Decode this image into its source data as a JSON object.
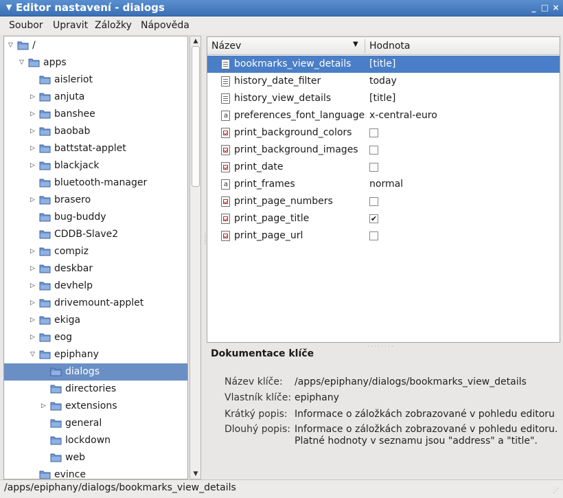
{
  "window": {
    "title": "Editor nastavení - dialogs",
    "menu_icon": "chevron-down-icon",
    "minimize": "_",
    "maximize": "□",
    "close": "×"
  },
  "menubar": [
    {
      "label": "Soubor"
    },
    {
      "label": "Upravit"
    },
    {
      "label": "Záložky"
    },
    {
      "label": "Nápověda"
    }
  ],
  "tree": {
    "items": [
      {
        "label": "/",
        "depth": 0,
        "expander": "open"
      },
      {
        "label": "apps",
        "depth": 1,
        "expander": "open"
      },
      {
        "label": "aisleriot",
        "depth": 2,
        "expander": "none"
      },
      {
        "label": "anjuta",
        "depth": 2,
        "expander": "closed"
      },
      {
        "label": "banshee",
        "depth": 2,
        "expander": "closed"
      },
      {
        "label": "baobab",
        "depth": 2,
        "expander": "closed"
      },
      {
        "label": "battstat-applet",
        "depth": 2,
        "expander": "closed"
      },
      {
        "label": "blackjack",
        "depth": 2,
        "expander": "closed"
      },
      {
        "label": "bluetooth-manager",
        "depth": 2,
        "expander": "none"
      },
      {
        "label": "brasero",
        "depth": 2,
        "expander": "closed"
      },
      {
        "label": "bug-buddy",
        "depth": 2,
        "expander": "none"
      },
      {
        "label": "CDDB-Slave2",
        "depth": 2,
        "expander": "none"
      },
      {
        "label": "compiz",
        "depth": 2,
        "expander": "closed"
      },
      {
        "label": "deskbar",
        "depth": 2,
        "expander": "closed"
      },
      {
        "label": "devhelp",
        "depth": 2,
        "expander": "closed"
      },
      {
        "label": "drivemount-applet",
        "depth": 2,
        "expander": "closed"
      },
      {
        "label": "ekiga",
        "depth": 2,
        "expander": "closed"
      },
      {
        "label": "eog",
        "depth": 2,
        "expander": "closed"
      },
      {
        "label": "epiphany",
        "depth": 2,
        "expander": "open"
      },
      {
        "label": "dialogs",
        "depth": 3,
        "expander": "none",
        "selected": true
      },
      {
        "label": "directories",
        "depth": 3,
        "expander": "none"
      },
      {
        "label": "extensions",
        "depth": 3,
        "expander": "closed"
      },
      {
        "label": "general",
        "depth": 3,
        "expander": "none"
      },
      {
        "label": "lockdown",
        "depth": 3,
        "expander": "none"
      },
      {
        "label": "web",
        "depth": 3,
        "expander": "none"
      },
      {
        "label": "evince",
        "depth": 2,
        "expander": "none"
      }
    ]
  },
  "keys": {
    "col_name": "Název",
    "col_value": "Hodnota",
    "rows": [
      {
        "name": "bookmarks_view_details",
        "type": "list",
        "value": "[title]",
        "selected": true
      },
      {
        "name": "history_date_filter",
        "type": "list",
        "value": "today"
      },
      {
        "name": "history_view_details",
        "type": "list",
        "value": "[title]"
      },
      {
        "name": "preferences_font_language",
        "type": "string",
        "value": "x-central-euro"
      },
      {
        "name": "print_background_colors",
        "type": "bool",
        "checked": false
      },
      {
        "name": "print_background_images",
        "type": "bool",
        "checked": false
      },
      {
        "name": "print_date",
        "type": "bool",
        "checked": false
      },
      {
        "name": "print_frames",
        "type": "string",
        "value": "normal"
      },
      {
        "name": "print_page_numbers",
        "type": "bool",
        "checked": false
      },
      {
        "name": "print_page_title",
        "type": "bool",
        "checked": true
      },
      {
        "name": "print_page_url",
        "type": "bool",
        "checked": false
      }
    ]
  },
  "doc": {
    "title": "Dokumentace klíče",
    "key_name_label": "Název klíče:",
    "key_name": "/apps/epiphany/dialogs/bookmarks_view_details",
    "owner_label": "Vlastník klíče:",
    "owner": "epiphany",
    "short_label": "Krátký popis:",
    "short": "Informace o záložkách zobrazované v pohledu editoru",
    "long_label": "Dlouhý popis:",
    "long_line1": "Informace o záložkách zobrazované v pohledu editoru.",
    "long_line2": "Platné hodnoty v seznamu jsou \"address\" a \"title\"."
  },
  "status": {
    "path": "/apps/epiphany/dialogs/bookmarks_view_details"
  },
  "colors": {
    "titlebar": "#4a7ec6",
    "selection": "#4a7ec6",
    "folder": "#6d97d6"
  }
}
